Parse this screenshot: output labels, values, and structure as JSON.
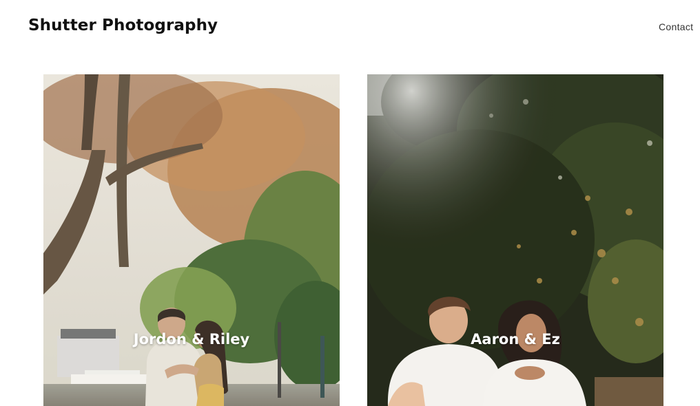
{
  "header": {
    "site_title": "Shutter Photography",
    "nav": {
      "contact_label": "Contact"
    }
  },
  "gallery": {
    "items": [
      {
        "caption": "Jordon & Riley",
        "photo_icon": "couple-photo-autumn-trees"
      },
      {
        "caption": "Aaron & Ez",
        "photo_icon": "couple-photo-dark-trees"
      }
    ]
  },
  "colors": {
    "background": "#ffffff",
    "text": "#111111",
    "caption": "#ffffff"
  }
}
